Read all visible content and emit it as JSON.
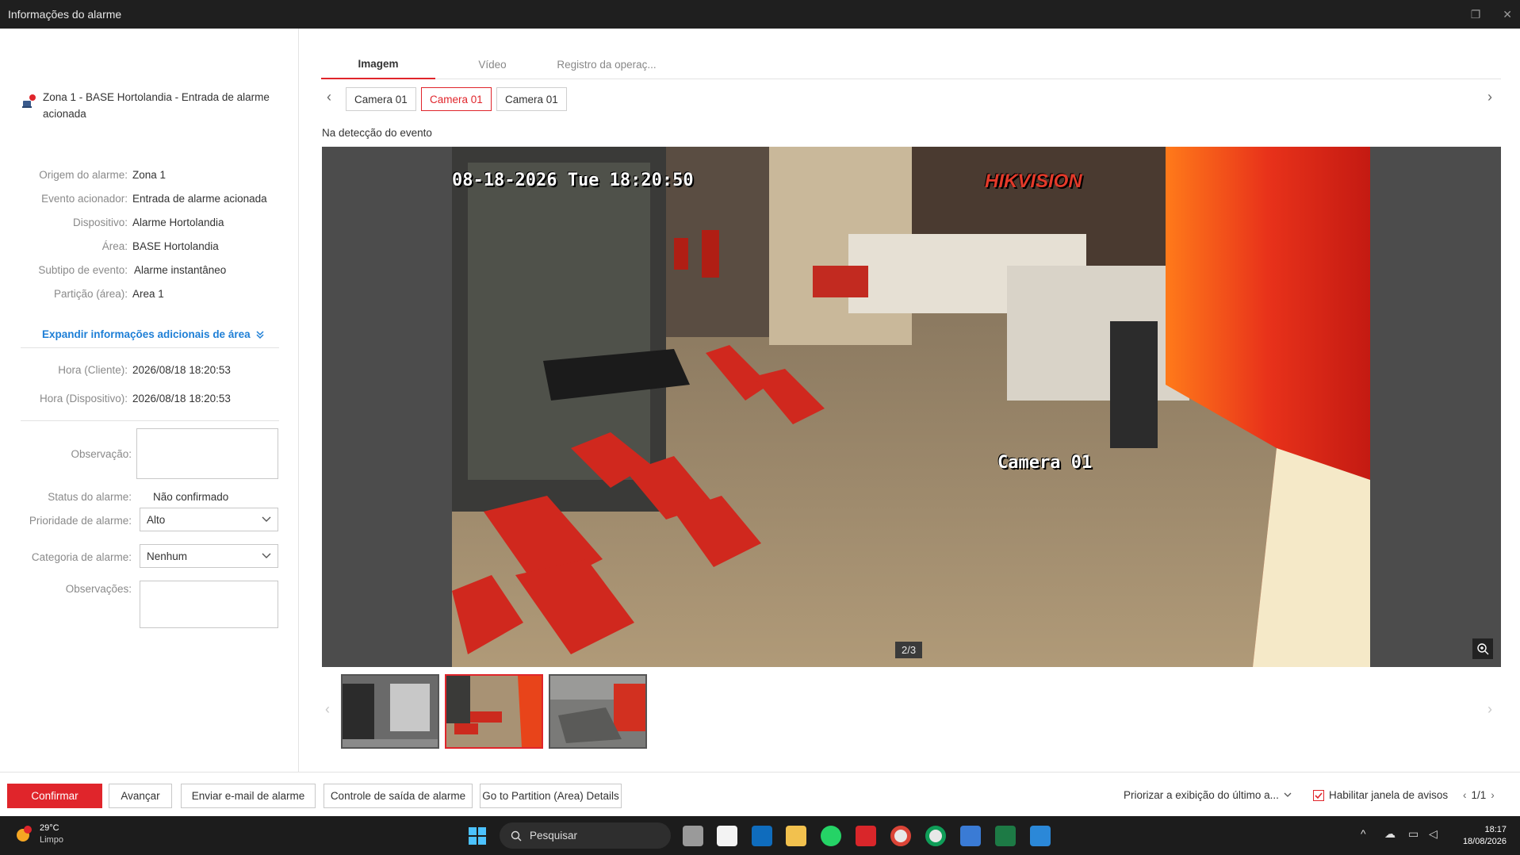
{
  "window": {
    "title": "Informações do alarme"
  },
  "alarm": {
    "title": "Zona 1 - BASE Hortolandia - Entrada de alarme acionada"
  },
  "details": [
    {
      "label": "Origem do alarme:",
      "value": "Zona 1"
    },
    {
      "label": "Evento acionador:",
      "value": "Entrada de alarme acionada"
    },
    {
      "label": "Dispositivo:",
      "value": "Alarme Hortolandia"
    },
    {
      "label": "Área:",
      "value": "BASE Hortolandia"
    },
    {
      "label": "Subtipo de evento:",
      "value": "Alarme instantâneo"
    },
    {
      "label": "Partição (área):",
      "value": "Area 1"
    }
  ],
  "expand_label": "Expandir informações adicionais de área",
  "times": [
    {
      "label": "Hora (Cliente):",
      "value": "2026/08/18 18:20:53"
    },
    {
      "label": "Hora (Dispositivo):",
      "value": "2026/08/18 18:20:53"
    }
  ],
  "form": {
    "observacao_label": "Observação:",
    "status_label": "Status do alarme:",
    "status_value": "Não confirmado",
    "prioridade_label": "Prioridade de alarme:",
    "prioridade_value": "Alto",
    "categoria_label": "Categoria de alarme:",
    "categoria_value": "Nenhum",
    "observacoes_label": "Observações:"
  },
  "tabs": [
    "Imagem",
    "Vídeo",
    "Registro da operaç..."
  ],
  "cameras": [
    "Camera 01",
    "Camera 01",
    "Camera 01"
  ],
  "event_label": "Na detecção do evento",
  "image": {
    "osd_time": "08-18-2026 Tue 18:20:50",
    "osd_brand": "HIKVISION",
    "osd_camera": "Camera 01",
    "counter": "2/3"
  },
  "footer": {
    "confirm": "Confirmar",
    "next": "Avançar",
    "email": "Enviar e-mail de alarme",
    "output": "Controle de saída de alarme",
    "partition": "Go to Partition (Area) Details",
    "priority_display": "Priorizar a exibição do último a...",
    "enable_popup": "Habilitar janela de avisos",
    "pages": "1/1"
  },
  "taskbar": {
    "weather_temp": "29°C",
    "weather_desc": "Limpo",
    "search": "Pesquisar",
    "time": "18:17",
    "date": "18/08/2026"
  },
  "colors": {
    "accent": "#e0252b",
    "link": "#1e7fd6",
    "titlebar": "#1f1f1f"
  }
}
